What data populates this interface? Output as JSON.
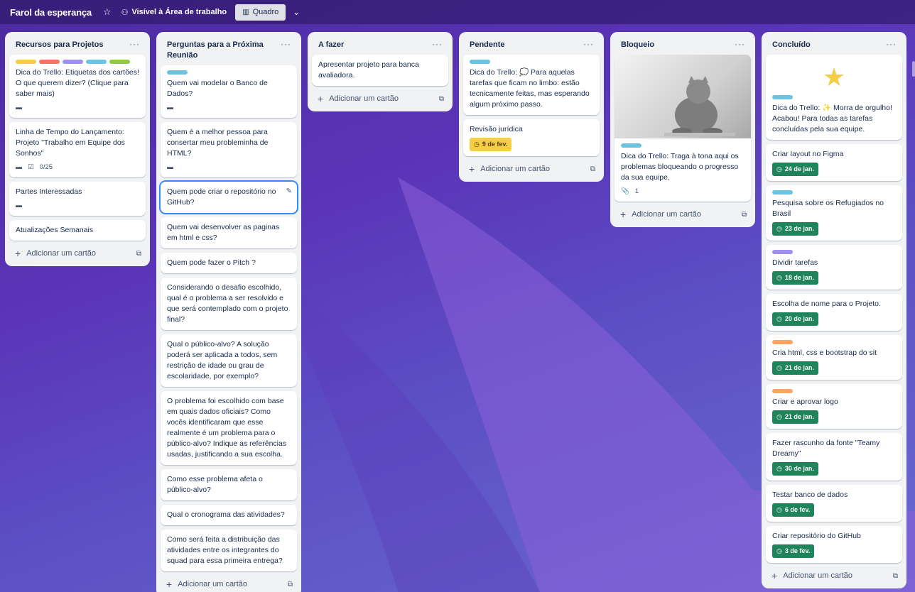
{
  "header": {
    "title": "Farol da esperança",
    "visibility": "Visível à Área de trabalho",
    "view": "Quadro"
  },
  "colors": {
    "yellow": "#f5cd47",
    "red": "#f87168",
    "purple": "#9f8fef",
    "sky": "#6cc3e0",
    "lime": "#94c748",
    "orange": "#fea362",
    "green_done": "#1f845a"
  },
  "add_card_label": "Adicionar um cartão",
  "lists": [
    {
      "title": "Recursos para Projetos",
      "cards": [
        {
          "text": "Dica do Trello: Etiquetas dos cartões! O que querem dizer? (Clique para saber mais)"
        },
        {
          "text": "Linha de Tempo do Lançamento: Projeto \"Trabalho em Equipe dos Sonhos\"",
          "checklist": "0/25"
        },
        {
          "text": "Partes Interessadas"
        },
        {
          "text": "Atualizações Semanais"
        }
      ]
    },
    {
      "title": "Perguntas para a Próxima Reunião",
      "cards": [
        {
          "text": "Quem vai modelar o Banco de Dados?"
        },
        {
          "text": "Quem é a melhor pessoa para consertar meu probleminha de HTML?"
        },
        {
          "text": "Quem pode criar o repositório no GitHub?"
        },
        {
          "text": "Quem vai desenvolver as paginas em html e css?"
        },
        {
          "text": "Quem pode fazer o Pitch ?"
        },
        {
          "text": "Considerando o desafio escolhido, qual é o problema a ser resolvido e que será contemplado com o projeto final?"
        },
        {
          "text": "Qual o público-alvo? A solução poderá ser aplicada a todos, sem restrição de idade ou grau de escolaridade, por exemplo?"
        },
        {
          "text": "O problema foi escolhido com base em quais dados oficiais? Como vocês identificaram que esse realmente é um problema para o público-alvo? Indique as referências usadas, justificando a sua escolha."
        },
        {
          "text": "Como esse problema afeta o público-alvo?"
        },
        {
          "text": "Qual o cronograma das atividades?"
        },
        {
          "text": "Como será feita a distribuição das atividades entre os integrantes do squad para essa primeira entrega?"
        }
      ]
    },
    {
      "title": "A fazer",
      "cards": [
        {
          "text": "Apresentar projeto para banca avaliadora."
        }
      ]
    },
    {
      "title": "Pendente",
      "cards": [
        {
          "text": "Dica do Trello: 💭 Para aquelas tarefas que ficam no limbo: estão tecnicamente feitas, mas esperando algum próximo passo."
        },
        {
          "text": "Revisão jurídica",
          "due": "9 de fev."
        }
      ]
    },
    {
      "title": "Bloqueio",
      "cards": [
        {
          "text": "Dica do Trello: Traga à tona aqui os problemas bloqueando o progresso da sua equipe.",
          "attachments": "1"
        }
      ]
    },
    {
      "title": "Concluído",
      "cards": [
        {
          "text": "Dica do Trello: ✨ Morra de orgulho! Acabou! Para todas as tarefas concluídas pela sua equipe."
        },
        {
          "text": "Criar layout no Figma",
          "due": "24 de jan."
        },
        {
          "text": "Pesquisa sobre os Refugiados no Brasil",
          "due": "23 de jan."
        },
        {
          "text": "Dividir tarefas",
          "due": "18 de jan."
        },
        {
          "text": "Escolha de nome para o Projeto.",
          "due": "20 de jan."
        },
        {
          "text": "Cria html, css e bootstrap do sit",
          "due": "21 de jan."
        },
        {
          "text": "Criar e aprovar logo",
          "due": "21 de jan."
        },
        {
          "text": "Fazer rascunho da fonte \"Teamy Dreamy\"",
          "due": "30 de jan."
        },
        {
          "text": "Testar banco de dados",
          "due": "6 de fev."
        },
        {
          "text": "Criar repositório do GitHub",
          "due": "3 de fev."
        }
      ]
    }
  ]
}
